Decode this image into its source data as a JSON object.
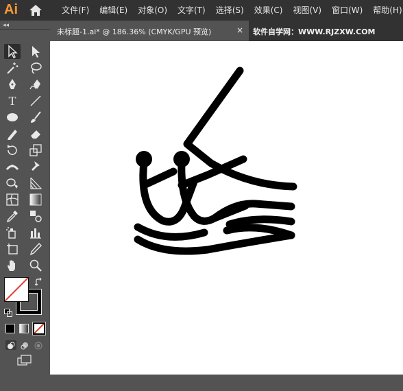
{
  "app": {
    "logo": "Ai"
  },
  "menu": [
    "文件(F)",
    "编辑(E)",
    "对象(O)",
    "文字(T)",
    "选择(S)",
    "效果(C)",
    "视图(V)",
    "窗口(W)",
    "帮助(H)"
  ],
  "tabs": {
    "document_title": "未标题-1.ai* @ 186.36% (CMYK/GPU 预览)",
    "close_glyph": "×",
    "site_label": "软件自学网：WWW.RJZXW.COM"
  },
  "panel": {
    "collapse_glyph": "◂◂"
  },
  "tools": {
    "type_label": "T",
    "fill_color": "#ffffff",
    "stroke_color": "#000000"
  },
  "colors": {
    "logo_accent": "#f59a36",
    "menubar_bg": "#323232",
    "panel_bg": "#535353"
  }
}
